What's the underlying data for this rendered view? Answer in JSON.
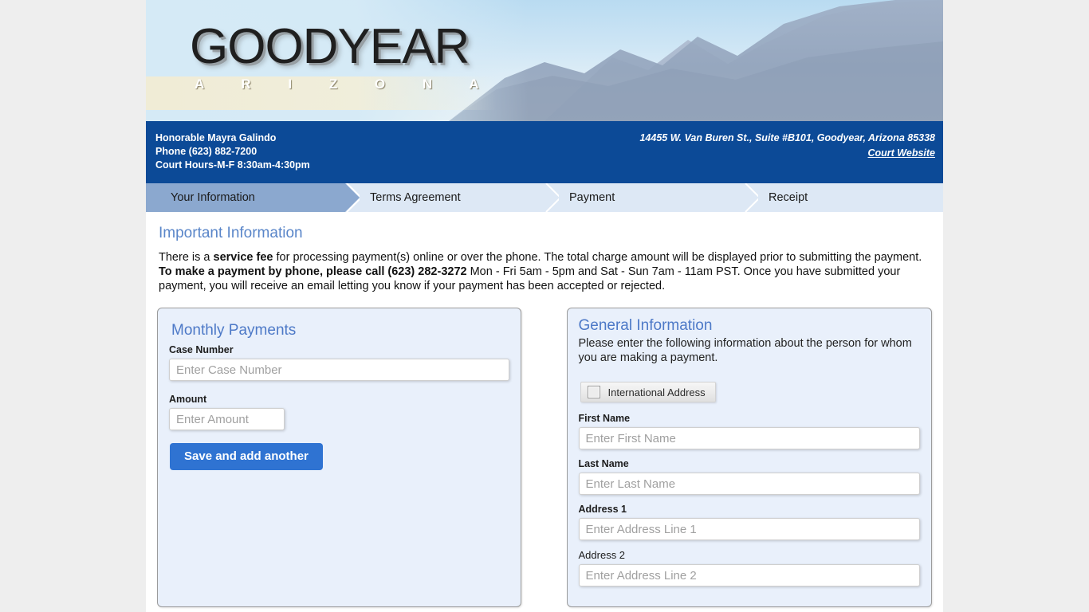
{
  "banner": {
    "logo_primary": "GOODYEAR",
    "logo_secondary": "A R I Z O N A"
  },
  "infobar": {
    "judge": "Honorable Mayra Galindo",
    "phone": "Phone (623) 882-7200",
    "hours": "Court Hours-M-F 8:30am-4:30pm",
    "address": "14455 W. Van Buren St., Suite #B101, Goodyear, Arizona 85338",
    "website_link": "Court Website",
    "bar_color": "#0c4a97"
  },
  "steps": {
    "active_index": 0,
    "items": [
      {
        "label": "Your Information"
      },
      {
        "label": "Terms Agreement"
      },
      {
        "label": "Payment"
      },
      {
        "label": "Receipt"
      }
    ],
    "active_color": "#8ba8cf",
    "inactive_color": "#dde8f5"
  },
  "important": {
    "heading": "Important Information",
    "p1_a": "There is a ",
    "p1_b_bold": "service fee",
    "p1_c": " for processing payment(s) online or over the phone. The total charge amount will be displayed prior to submitting the payment. ",
    "p1_d_bold": "To make a payment by phone, please call (623) 282-3272",
    "p1_e": " Mon - Fri 5am - 5pm and Sat - Sun 7am - 11am PST. Once you have submitted your payment, you will receive an email letting you know if your payment has been accepted or rejected."
  },
  "monthly_payments": {
    "title": "Monthly Payments",
    "case_number_label": "Case Number",
    "case_number_placeholder": "Enter Case Number",
    "case_number_value": "",
    "amount_label": "Amount",
    "amount_placeholder": "Enter Amount",
    "amount_value": "",
    "save_button": "Save and add another",
    "button_color": "#2f73d2"
  },
  "general_information": {
    "title": "General Information",
    "subtitle": "Please enter the following information about the person for whom you are making a payment.",
    "international_address_label": "International Address",
    "international_address_checked": false,
    "first_name_label": "First Name",
    "first_name_placeholder": "Enter First Name",
    "first_name_value": "",
    "last_name_label": "Last Name",
    "last_name_placeholder": "Enter Last Name",
    "last_name_value": "",
    "address1_label": "Address 1",
    "address1_placeholder": "Enter Address Line 1",
    "address1_value": "",
    "address2_label": "Address 2",
    "address2_placeholder": "Enter Address Line 2",
    "address2_value": ""
  }
}
